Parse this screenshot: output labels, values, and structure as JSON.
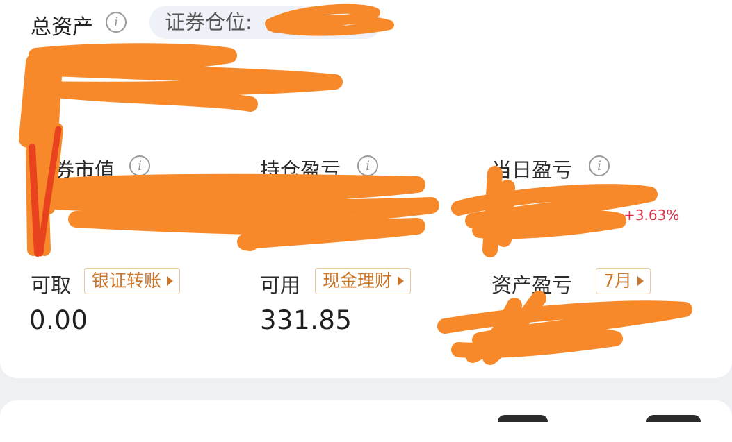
{
  "header": {
    "total_assets_label": "总资产",
    "position_label": "证券仓位:"
  },
  "stats": {
    "market_value_label": "券市值",
    "holding_pnl_label": "持仓盈亏",
    "daily_pnl_label": "当日盈亏",
    "daily_pnl_pct": "+3.63%"
  },
  "funds": {
    "withdrawable_label": "可取",
    "withdrawable_value": "0.00",
    "transfer_button": "银证转账",
    "available_label": "可用",
    "available_value": "331.85",
    "wealth_button": "现金理财",
    "asset_pnl_label": "资产盈亏",
    "month_button": "7月"
  },
  "icons": {
    "info": "info-icon",
    "tag_arrow": "triangle-right-icon"
  },
  "colors": {
    "accent_orange": "#c9762a",
    "gain_red": "#d4354b",
    "scribble_orange": "#f7892a"
  }
}
